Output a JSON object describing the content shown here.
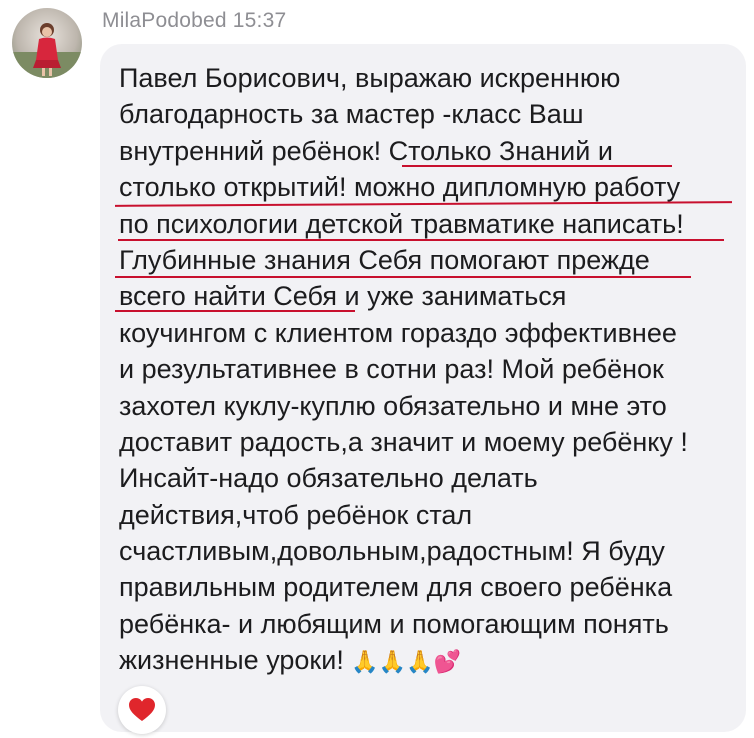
{
  "comment": {
    "author": "MilaPodobed",
    "time": "15:37",
    "lines": [
      "Павел Борисович, выражаю искреннюю",
      "благодарность за мастер -класс Ваш",
      "внутренний ребёнок! Столько Знаний и",
      "столько открытий! можно дипломную работу",
      "по психологии детской травматике написать!",
      "Глубинные знания Себя помогают прежде",
      "всего найти Себя и уже заниматься",
      "коучингом с клиентом гораздо эффективнее",
      "и результативнее в сотни раз! Мой ребёнок",
      "захотел куклу-куплю обязательно и мне это",
      "доставит радость,а значит и моему ребёнку !",
      "Инсайт-надо обязательно делать",
      "действия,чтоб ребёнок стал",
      "счастливым,довольным,радостным! Я буду",
      "правильным родителем для своего ребёнка",
      "ребёнка- и любящим и помогающим понять",
      "жизненные уроки!"
    ],
    "emojis": "🙏🙏🙏💕"
  },
  "reaction": {
    "icon": "heart-icon",
    "color": "#e0262c"
  },
  "colors": {
    "bubble": "#f2f2f5",
    "meta": "#8e8e93",
    "text": "#1c1c1e",
    "underline": "#c8102e"
  }
}
